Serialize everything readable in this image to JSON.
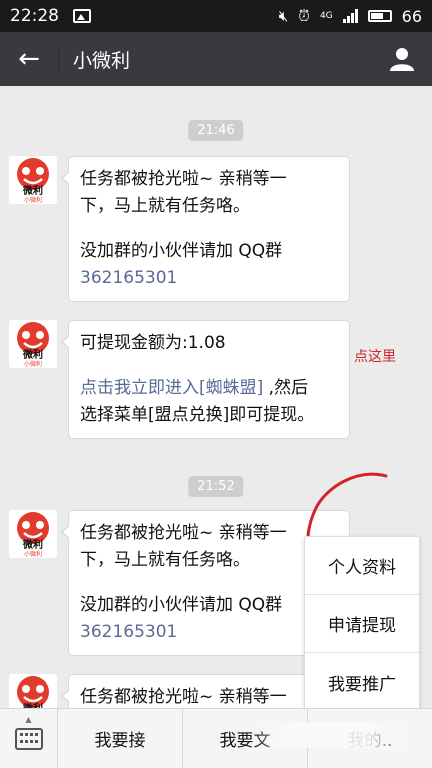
{
  "status_bar": {
    "time": "22:28",
    "network": "4G",
    "battery": "66",
    "icons": [
      "image-icon",
      "mute-icon",
      "alarm-icon",
      "signal-icon",
      "battery-icon"
    ]
  },
  "header": {
    "title": "小微利",
    "back_icon": "arrow-left-icon",
    "profile_icon": "person-icon",
    "bg_color": "#393a3f"
  },
  "chat": {
    "timestamps": [
      "21:46",
      "21:52"
    ],
    "avatar_text": "微利",
    "avatar_subtext": "小微利",
    "messages": [
      {
        "line1": "任务都被抢光啦~ 亲稍等一",
        "line2": "下，马上就有任务咯。",
        "line3": "没加群的小伙伴请加 QQ群",
        "line4": "362165301"
      },
      {
        "line1": "可提现金额为:1.08",
        "link": "点击我立即进入[蜘蛛盟]",
        "line2_rest": " ,然后",
        "line3": "选择菜单[盟点兑换]即可提现。"
      },
      {
        "line1": "任务都被抢光啦~ 亲稍等一",
        "line2": "下，马上就有任务咯。",
        "line3": "没加群的小伙伴请加 QQ群",
        "line4": "362165301"
      },
      {
        "line1": "任务都被抢光啦~ 亲稍等一"
      }
    ]
  },
  "annotation": {
    "text": "点这里",
    "color": "#d0242a"
  },
  "popup_menu": {
    "items": [
      "个人资料",
      "申请提现",
      "我要推广"
    ]
  },
  "bottom_menu": {
    "keyboard_icon": "keyboard-icon",
    "buttons": [
      "我要接",
      "我要文",
      "我的.."
    ]
  },
  "colors": {
    "link": "#576b95",
    "background": "#ebebeb"
  }
}
